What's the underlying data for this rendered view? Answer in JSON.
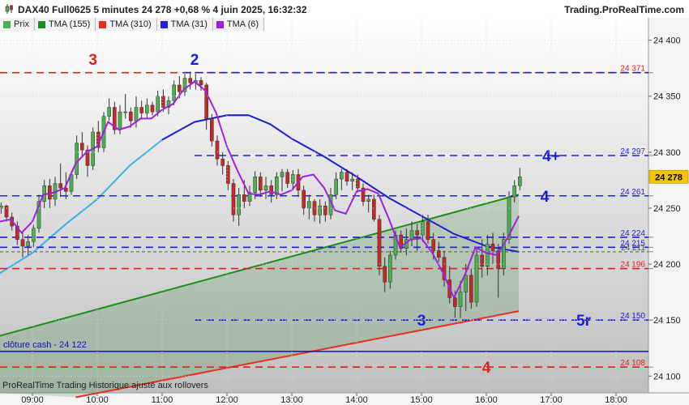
{
  "header": {
    "title": "DAX40 Full0625 5 minutes 24 278 +0,68 % 4 juin 2025, 16:32:32",
    "brand": "Trading.ProRealTime.com"
  },
  "legend": [
    {
      "label": "Prix",
      "color": "#4caf50"
    },
    {
      "label": "TMA (155)",
      "color": "#1a8f1a"
    },
    {
      "label": "TMA (310)",
      "color": "#e53020"
    },
    {
      "label": "TMA (31)",
      "color": "#2020d0"
    },
    {
      "label": "TMA (6)",
      "color": "#a020e0"
    }
  ],
  "footnote": "ProRealTime Trading  Historique ajusté aux rollovers",
  "colors": {
    "bull": "#4caf50",
    "bear": "#c62828",
    "tma155": "#1a8f1a",
    "tma310": "#e53020",
    "tma31": "#2020d0",
    "tma6": "#a020e0",
    "cyan": "#3ab0e8",
    "level_red": "#e02020",
    "level_blue": "#2020d8",
    "cloture": "#1010c0"
  },
  "chart_data": {
    "type": "candlestick",
    "ylim": [
      24085,
      24420
    ],
    "xlim": [
      "08:30",
      "18:30"
    ],
    "x_ticks": [
      "09:00",
      "10:00",
      "11:00",
      "12:00",
      "13:00",
      "14:00",
      "15:00",
      "16:00",
      "17:00",
      "18:00"
    ],
    "y_ticks": [
      "24 400",
      "24 350",
      "24 300",
      "24 250",
      "24 200",
      "24 150",
      "24 100"
    ],
    "last_price": {
      "value": 24278,
      "label": "24 278"
    },
    "levels": [
      {
        "value": 24371,
        "label": "24 371",
        "color": "red",
        "from": "08:30"
      },
      {
        "value": 24371,
        "label": "",
        "color": "blue",
        "from": "11:20"
      },
      {
        "value": 24297,
        "label": "24 297",
        "color": "blue",
        "from": "11:30"
      },
      {
        "value": 24261,
        "label": "24 261",
        "color": "blue",
        "from": "08:30"
      },
      {
        "value": 24224,
        "label": "24 224",
        "color": "blue",
        "from": "08:30"
      },
      {
        "value": 24215,
        "label": "24 215",
        "color": "blue",
        "from": "08:30"
      },
      {
        "value": 24211,
        "label": "24 211",
        "color": "gray",
        "from": "08:30"
      },
      {
        "value": 24196,
        "label": "24 196",
        "color": "red",
        "from": "08:30"
      },
      {
        "value": 24150,
        "label": "24 150",
        "color": "blue",
        "from": "11:30"
      },
      {
        "value": 24108,
        "label": "24 108",
        "color": "red",
        "from": "08:30"
      }
    ],
    "cloture": {
      "value": 24122,
      "label": "clôture cash -  24 122"
    },
    "annotations": [
      {
        "text": "3",
        "time": "09:56",
        "value": 24383,
        "color": "red"
      },
      {
        "text": "2",
        "time": "11:30",
        "value": 24383,
        "color": "blue"
      },
      {
        "text": "4+",
        "time": "17:00",
        "value": 24297,
        "color": "blue"
      },
      {
        "text": "4",
        "time": "16:54",
        "value": 24261,
        "color": "blue"
      },
      {
        "text": "3",
        "time": "15:00",
        "value": 24150,
        "color": "blue"
      },
      {
        "text": "5r",
        "time": "17:30",
        "value": 24150,
        "color": "blue"
      },
      {
        "text": "4",
        "time": "16:00",
        "value": 24108,
        "color": "red"
      }
    ],
    "tma155": {
      "from": [
        "08:30",
        24136
      ],
      "to": [
        "16:30",
        24262
      ]
    },
    "tma310": {
      "from": [
        "09:40",
        24081
      ],
      "to": [
        "16:30",
        24158
      ]
    },
    "tma31": [
      [
        "08:30",
        24192
      ],
      [
        "09:00",
        24210
      ],
      [
        "09:30",
        24235
      ],
      [
        "10:00",
        24258
      ],
      [
        "10:30",
        24288
      ],
      [
        "11:00",
        24311
      ],
      [
        "11:30",
        24327
      ],
      [
        "12:00",
        24333
      ],
      [
        "12:20",
        24333
      ],
      [
        "12:40",
        24325
      ],
      [
        "13:00",
        24312
      ],
      [
        "13:30",
        24296
      ],
      [
        "14:00",
        24278
      ],
      [
        "14:30",
        24259
      ],
      [
        "15:00",
        24243
      ],
      [
        "15:30",
        24227
      ],
      [
        "16:00",
        24216
      ],
      [
        "16:30",
        24211
      ]
    ],
    "tma6": [
      [
        "08:30",
        24238
      ],
      [
        "08:40",
        24240
      ],
      [
        "08:50",
        24228
      ],
      [
        "09:00",
        24238
      ],
      [
        "09:10",
        24262
      ],
      [
        "09:20",
        24264
      ],
      [
        "09:30",
        24268
      ],
      [
        "09:40",
        24290
      ],
      [
        "09:50",
        24300
      ],
      [
        "10:00",
        24305
      ],
      [
        "10:10",
        24327
      ],
      [
        "10:20",
        24320
      ],
      [
        "10:30",
        24323
      ],
      [
        "10:40",
        24330
      ],
      [
        "10:50",
        24330
      ],
      [
        "11:00",
        24338
      ],
      [
        "11:10",
        24343
      ],
      [
        "11:20",
        24356
      ],
      [
        "11:30",
        24363
      ],
      [
        "11:40",
        24355
      ],
      [
        "11:50",
        24335
      ],
      [
        "12:00",
        24305
      ],
      [
        "12:10",
        24283
      ],
      [
        "12:20",
        24263
      ],
      [
        "12:30",
        24262
      ],
      [
        "12:40",
        24265
      ],
      [
        "12:50",
        24262
      ],
      [
        "13:00",
        24266
      ],
      [
        "13:10",
        24278
      ],
      [
        "13:20",
        24280
      ],
      [
        "13:30",
        24268
      ],
      [
        "13:40",
        24248
      ],
      [
        "13:50",
        24245
      ],
      [
        "14:00",
        24265
      ],
      [
        "14:10",
        24267
      ],
      [
        "14:20",
        24263
      ],
      [
        "14:30",
        24240
      ],
      [
        "14:40",
        24215
      ],
      [
        "14:50",
        24222
      ],
      [
        "15:00",
        24223
      ],
      [
        "15:10",
        24210
      ],
      [
        "15:20",
        24192
      ],
      [
        "15:30",
        24170
      ],
      [
        "15:40",
        24190
      ],
      [
        "15:50",
        24215
      ],
      [
        "16:00",
        24210
      ],
      [
        "16:10",
        24208
      ],
      [
        "16:20",
        24224
      ],
      [
        "16:30",
        24243
      ]
    ],
    "candles": [
      {
        "t": "08:31",
        "o": 24250,
        "h": 24255,
        "l": 24245,
        "c": 24252
      },
      {
        "t": "08:36",
        "o": 24252,
        "h": 24253,
        "l": 24238,
        "c": 24242
      },
      {
        "t": "08:41",
        "o": 24242,
        "h": 24246,
        "l": 24230,
        "c": 24234
      },
      {
        "t": "08:46",
        "o": 24234,
        "h": 24238,
        "l": 24217,
        "c": 24222
      },
      {
        "t": "08:51",
        "o": 24222,
        "h": 24228,
        "l": 24206,
        "c": 24216
      },
      {
        "t": "08:56",
        "o": 24216,
        "h": 24226,
        "l": 24208,
        "c": 24220
      },
      {
        "t": "09:01",
        "o": 24220,
        "h": 24235,
        "l": 24215,
        "c": 24232
      },
      {
        "t": "09:06",
        "o": 24232,
        "h": 24262,
        "l": 24228,
        "c": 24256
      },
      {
        "t": "09:11",
        "o": 24256,
        "h": 24275,
        "l": 24250,
        "c": 24270
      },
      {
        "t": "09:16",
        "o": 24270,
        "h": 24276,
        "l": 24250,
        "c": 24258
      },
      {
        "t": "09:21",
        "o": 24258,
        "h": 24278,
        "l": 24252,
        "c": 24272
      },
      {
        "t": "09:26",
        "o": 24272,
        "h": 24290,
        "l": 24260,
        "c": 24268
      },
      {
        "t": "09:31",
        "o": 24268,
        "h": 24282,
        "l": 24258,
        "c": 24265
      },
      {
        "t": "09:36",
        "o": 24265,
        "h": 24283,
        "l": 24262,
        "c": 24280
      },
      {
        "t": "09:41",
        "o": 24280,
        "h": 24315,
        "l": 24276,
        "c": 24308
      },
      {
        "t": "09:46",
        "o": 24308,
        "h": 24318,
        "l": 24295,
        "c": 24302
      },
      {
        "t": "09:51",
        "o": 24302,
        "h": 24306,
        "l": 24278,
        "c": 24288
      },
      {
        "t": "09:56",
        "o": 24288,
        "h": 24322,
        "l": 24284,
        "c": 24318
      },
      {
        "t": "10:01",
        "o": 24318,
        "h": 24328,
        "l": 24300,
        "c": 24304
      },
      {
        "t": "10:06",
        "o": 24304,
        "h": 24336,
        "l": 24300,
        "c": 24332
      },
      {
        "t": "10:11",
        "o": 24332,
        "h": 24348,
        "l": 24328,
        "c": 24340
      },
      {
        "t": "10:16",
        "o": 24340,
        "h": 24345,
        "l": 24316,
        "c": 24320
      },
      {
        "t": "10:21",
        "o": 24320,
        "h": 24342,
        "l": 24316,
        "c": 24336
      },
      {
        "t": "10:26",
        "o": 24336,
        "h": 24352,
        "l": 24330,
        "c": 24336
      },
      {
        "t": "10:31",
        "o": 24336,
        "h": 24340,
        "l": 24322,
        "c": 24328
      },
      {
        "t": "10:36",
        "o": 24328,
        "h": 24350,
        "l": 24322,
        "c": 24340
      },
      {
        "t": "10:41",
        "o": 24340,
        "h": 24346,
        "l": 24330,
        "c": 24335
      },
      {
        "t": "10:46",
        "o": 24335,
        "h": 24348,
        "l": 24330,
        "c": 24342
      },
      {
        "t": "10:51",
        "o": 24342,
        "h": 24345,
        "l": 24333,
        "c": 24336
      },
      {
        "t": "10:56",
        "o": 24336,
        "h": 24355,
        "l": 24332,
        "c": 24350
      },
      {
        "t": "11:01",
        "o": 24350,
        "h": 24356,
        "l": 24336,
        "c": 24340
      },
      {
        "t": "11:06",
        "o": 24340,
        "h": 24350,
        "l": 24334,
        "c": 24346
      },
      {
        "t": "11:11",
        "o": 24346,
        "h": 24364,
        "l": 24342,
        "c": 24360
      },
      {
        "t": "11:16",
        "o": 24360,
        "h": 24368,
        "l": 24348,
        "c": 24354
      },
      {
        "t": "11:21",
        "o": 24354,
        "h": 24370,
        "l": 24350,
        "c": 24366
      },
      {
        "t": "11:26",
        "o": 24366,
        "h": 24372,
        "l": 24356,
        "c": 24362
      },
      {
        "t": "11:31",
        "o": 24362,
        "h": 24370,
        "l": 24356,
        "c": 24364
      },
      {
        "t": "11:36",
        "o": 24364,
        "h": 24367,
        "l": 24355,
        "c": 24360
      },
      {
        "t": "11:41",
        "o": 24360,
        "h": 24362,
        "l": 24320,
        "c": 24330
      },
      {
        "t": "11:46",
        "o": 24330,
        "h": 24334,
        "l": 24305,
        "c": 24310
      },
      {
        "t": "11:51",
        "o": 24310,
        "h": 24315,
        "l": 24288,
        "c": 24294
      },
      {
        "t": "11:56",
        "o": 24294,
        "h": 24300,
        "l": 24280,
        "c": 24288
      },
      {
        "t": "12:01",
        "o": 24288,
        "h": 24292,
        "l": 24266,
        "c": 24272
      },
      {
        "t": "12:06",
        "o": 24272,
        "h": 24276,
        "l": 24238,
        "c": 24244
      },
      {
        "t": "12:11",
        "o": 24244,
        "h": 24268,
        "l": 24234,
        "c": 24262
      },
      {
        "t": "12:16",
        "o": 24262,
        "h": 24275,
        "l": 24250,
        "c": 24256
      },
      {
        "t": "12:21",
        "o": 24256,
        "h": 24270,
        "l": 24252,
        "c": 24264
      },
      {
        "t": "12:26",
        "o": 24264,
        "h": 24283,
        "l": 24258,
        "c": 24278
      },
      {
        "t": "12:31",
        "o": 24278,
        "h": 24282,
        "l": 24260,
        "c": 24266
      },
      {
        "t": "12:36",
        "o": 24266,
        "h": 24278,
        "l": 24258,
        "c": 24270
      },
      {
        "t": "12:41",
        "o": 24270,
        "h": 24275,
        "l": 24255,
        "c": 24262
      },
      {
        "t": "12:46",
        "o": 24262,
        "h": 24282,
        "l": 24258,
        "c": 24278
      },
      {
        "t": "12:51",
        "o": 24278,
        "h": 24285,
        "l": 24265,
        "c": 24282
      },
      {
        "t": "12:56",
        "o": 24282,
        "h": 24285,
        "l": 24268,
        "c": 24272
      },
      {
        "t": "13:01",
        "o": 24272,
        "h": 24284,
        "l": 24266,
        "c": 24280
      },
      {
        "t": "13:06",
        "o": 24280,
        "h": 24285,
        "l": 24260,
        "c": 24266
      },
      {
        "t": "13:11",
        "o": 24266,
        "h": 24270,
        "l": 24244,
        "c": 24250
      },
      {
        "t": "13:16",
        "o": 24250,
        "h": 24262,
        "l": 24240,
        "c": 24256
      },
      {
        "t": "13:21",
        "o": 24256,
        "h": 24258,
        "l": 24238,
        "c": 24244
      },
      {
        "t": "13:26",
        "o": 24244,
        "h": 24258,
        "l": 24236,
        "c": 24252
      },
      {
        "t": "13:31",
        "o": 24252,
        "h": 24256,
        "l": 24238,
        "c": 24244
      },
      {
        "t": "13:36",
        "o": 24244,
        "h": 24268,
        "l": 24240,
        "c": 24262
      },
      {
        "t": "13:41",
        "o": 24262,
        "h": 24282,
        "l": 24258,
        "c": 24276
      },
      {
        "t": "13:46",
        "o": 24276,
        "h": 24285,
        "l": 24266,
        "c": 24282
      },
      {
        "t": "13:51",
        "o": 24282,
        "h": 24285,
        "l": 24270,
        "c": 24274
      },
      {
        "t": "13:56",
        "o": 24274,
        "h": 24282,
        "l": 24266,
        "c": 24276
      },
      {
        "t": "14:01",
        "o": 24276,
        "h": 24280,
        "l": 24264,
        "c": 24268
      },
      {
        "t": "14:06",
        "o": 24268,
        "h": 24272,
        "l": 24252,
        "c": 24256
      },
      {
        "t": "14:11",
        "o": 24256,
        "h": 24262,
        "l": 24246,
        "c": 24258
      },
      {
        "t": "14:16",
        "o": 24258,
        "h": 24262,
        "l": 24238,
        "c": 24240
      },
      {
        "t": "14:21",
        "o": 24240,
        "h": 24244,
        "l": 24190,
        "c": 24198
      },
      {
        "t": "14:26",
        "o": 24198,
        "h": 24206,
        "l": 24175,
        "c": 24184
      },
      {
        "t": "14:31",
        "o": 24184,
        "h": 24212,
        "l": 24178,
        "c": 24208
      },
      {
        "t": "14:36",
        "o": 24208,
        "h": 24230,
        "l": 24204,
        "c": 24226
      },
      {
        "t": "14:41",
        "o": 24226,
        "h": 24230,
        "l": 24210,
        "c": 24214
      },
      {
        "t": "14:46",
        "o": 24214,
        "h": 24232,
        "l": 24208,
        "c": 24222
      },
      {
        "t": "14:51",
        "o": 24222,
        "h": 24238,
        "l": 24216,
        "c": 24230
      },
      {
        "t": "14:56",
        "o": 24230,
        "h": 24236,
        "l": 24212,
        "c": 24226
      },
      {
        "t": "15:01",
        "o": 24226,
        "h": 24244,
        "l": 24220,
        "c": 24238
      },
      {
        "t": "15:06",
        "o": 24238,
        "h": 24244,
        "l": 24218,
        "c": 24222
      },
      {
        "t": "15:11",
        "o": 24222,
        "h": 24228,
        "l": 24204,
        "c": 24212
      },
      {
        "t": "15:16",
        "o": 24212,
        "h": 24220,
        "l": 24202,
        "c": 24206
      },
      {
        "t": "15:21",
        "o": 24206,
        "h": 24212,
        "l": 24180,
        "c": 24186
      },
      {
        "t": "15:26",
        "o": 24186,
        "h": 24198,
        "l": 24165,
        "c": 24170
      },
      {
        "t": "15:31",
        "o": 24170,
        "h": 24176,
        "l": 24152,
        "c": 24162
      },
      {
        "t": "15:36",
        "o": 24162,
        "h": 24185,
        "l": 24152,
        "c": 24175
      },
      {
        "t": "15:41",
        "o": 24175,
        "h": 24200,
        "l": 24158,
        "c": 24190
      },
      {
        "t": "15:46",
        "o": 24190,
        "h": 24196,
        "l": 24160,
        "c": 24166
      },
      {
        "t": "15:51",
        "o": 24166,
        "h": 24215,
        "l": 24162,
        "c": 24208
      },
      {
        "t": "15:56",
        "o": 24208,
        "h": 24222,
        "l": 24188,
        "c": 24198
      },
      {
        "t": "16:01",
        "o": 24198,
        "h": 24226,
        "l": 24190,
        "c": 24218
      },
      {
        "t": "16:06",
        "o": 24218,
        "h": 24228,
        "l": 24200,
        "c": 24212
      },
      {
        "t": "16:11",
        "o": 24212,
        "h": 24218,
        "l": 24170,
        "c": 24196
      },
      {
        "t": "16:16",
        "o": 24196,
        "h": 24228,
        "l": 24190,
        "c": 24222
      },
      {
        "t": "16:21",
        "o": 24222,
        "h": 24265,
        "l": 24218,
        "c": 24260
      },
      {
        "t": "16:26",
        "o": 24260,
        "h": 24275,
        "l": 24255,
        "c": 24270
      },
      {
        "t": "16:31",
        "o": 24270,
        "h": 24286,
        "l": 24266,
        "c": 24278
      }
    ]
  }
}
